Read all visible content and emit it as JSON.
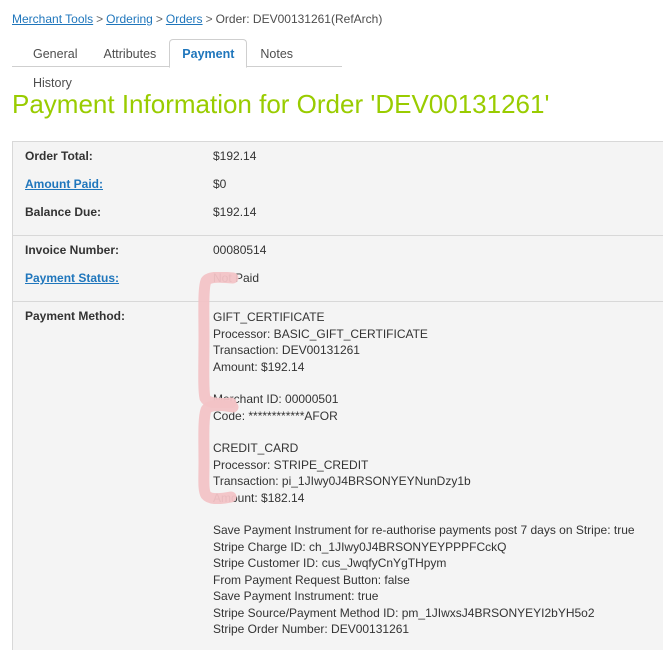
{
  "breadcrumb": {
    "items": [
      {
        "label": "Merchant Tools",
        "link": true
      },
      {
        "label": "Ordering",
        "link": true
      },
      {
        "label": "Orders",
        "link": true
      },
      {
        "label": "Order: DEV00131261(RefArch)",
        "link": false
      }
    ],
    "separator": ">"
  },
  "tabs": [
    {
      "label": "General",
      "active": false
    },
    {
      "label": "Attributes",
      "active": false
    },
    {
      "label": "Payment",
      "active": true
    },
    {
      "label": "Notes",
      "active": false
    },
    {
      "label": "History",
      "active": false
    }
  ],
  "page_title": "Payment Information for Order 'DEV00131261'",
  "summary": {
    "order_total_label": "Order Total:",
    "order_total_value": "$192.14",
    "amount_paid_label": "Amount Paid:",
    "amount_paid_value": "$0",
    "balance_due_label": "Balance Due:",
    "balance_due_value": "$192.14"
  },
  "invoice": {
    "invoice_number_label": "Invoice Number:",
    "invoice_number_value": "00080514",
    "payment_status_label": "Payment Status:",
    "payment_status_value": "Not Paid"
  },
  "payment_method": {
    "label": "Payment Method:",
    "gift_certificate": {
      "type": "GIFT_CERTIFICATE",
      "processor": "Processor: BASIC_GIFT_CERTIFICATE",
      "transaction": "Transaction: DEV00131261",
      "amount": "Amount: $192.14",
      "merchant_id": "Merchant ID: 00000501",
      "code": "Code: ************AFOR"
    },
    "credit_card": {
      "type": "CREDIT_CARD",
      "processor": "Processor: STRIPE_CREDIT",
      "transaction": "Transaction: pi_1JIwy0J4BRSONYEYNunDzy1b",
      "amount": "Amount: $182.14"
    },
    "extra_lines": [
      "Save Payment Instrument for re-authorise payments post 7 days on Stripe: true",
      "Stripe Charge ID: ch_1JIwy0J4BRSONYEYPPPFCckQ",
      "Stripe Customer ID: cus_JwqfyCnYgTHpym",
      "From Payment Request Button: false",
      "Save Payment Instrument: true",
      "Stripe Source/Payment Method ID: pm_1JIwxsJ4BRSONYEYI2bYH5o2",
      "Stripe Order Number: DEV00131261"
    ]
  },
  "annotations": {
    "bracket_color": "#f3c6c8",
    "bracket_gift_certificate_name": "gift-certificate-highlight-bracket",
    "bracket_credit_card_name": "credit-card-highlight-bracket"
  },
  "colors": {
    "title_green": "#99cc00",
    "link_blue": "#1f76bc",
    "table_bg": "#f4f4f4",
    "border_gray": "#d8d8d8"
  }
}
